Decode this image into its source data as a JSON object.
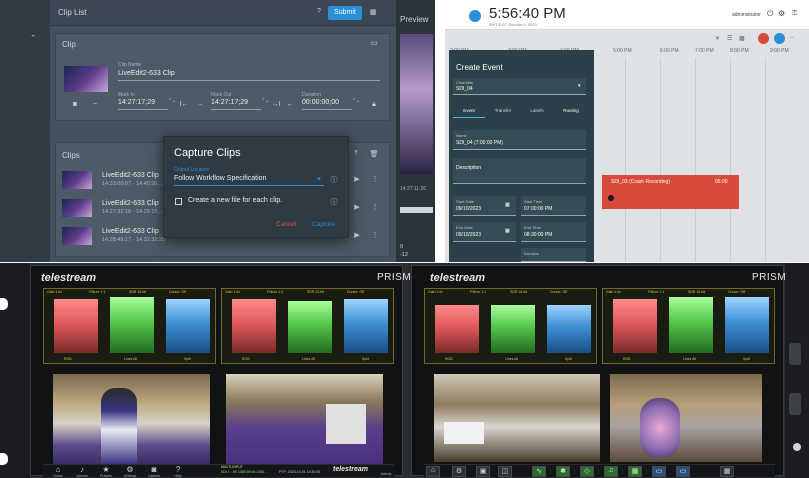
{
  "panel_a": {
    "title": "Clip List",
    "submit": "Submit",
    "preview": "Preview",
    "clip_section": "Clip",
    "clip_name_label": "Clip Name",
    "clip_name": "LiveEdit2-633 Clip",
    "mark_in_label": "Mark In",
    "mark_in": "14:27:17;29",
    "mark_out_label": "Mark Out",
    "mark_out": "14:27:17;29",
    "duration_label": "Duration",
    "duration": "00:00:00;00",
    "clips_section": "Clips",
    "rows": [
      {
        "title": "LiveEdit2-633 Clip",
        "sub": "14:33:00;07 - 14:40:26;..."
      },
      {
        "title": "LiveEdit2-633 Clip",
        "sub": "14:27:32;18 - 14:29:15;..."
      },
      {
        "title": "LiveEdit2-633 Clip",
        "sub": "14:28:49;17 - 14:31:32;25"
      }
    ],
    "preview_tc": "14:27:11:26",
    "dialog": {
      "title": "Capture Clips",
      "output_label": "Output Location",
      "output_value": "Follow Workflow Specification",
      "checkbox": "Create a new file for each clip.",
      "cancel": "Cancel",
      "capture": "Capture"
    },
    "preview_scale": [
      "0",
      "-12"
    ]
  },
  "panel_b": {
    "time": "5:56:40 PM",
    "time_sub": "WPT/EDT    October 9, 2023",
    "admin": "administrator",
    "hours": [
      "2:00 PM",
      "3:00 PM",
      "4:00 PM",
      "5:00 PM",
      "6:00 PM",
      "7:00 PM",
      "8:00 PM",
      "9:00 PM"
    ],
    "create_event": {
      "title": "Create Event",
      "channels_label": "Channels",
      "channel": "SDI_04",
      "tabs": [
        "Event",
        "Transfer",
        "Labels",
        "Routing"
      ],
      "name_label": "Name",
      "name": "SDI_04 (7:00:00 PM)",
      "description_label": "Description",
      "start_date_label": "Start Date",
      "start_date": "09/10/2023",
      "start_time_label": "Start Time",
      "start_time": "07:00:00 PM",
      "end_date_label": "End Date",
      "end_date": "09/10/2023",
      "end_time_label": "End Time",
      "end_time": "08:30:00 PM",
      "duration_label": "Duration"
    },
    "event_block": "SDI_03 (Crash Recording)",
    "event_time": "05:00"
  },
  "rack": {
    "left": {
      "brand": "telestream",
      "model": "PRISM",
      "scope_headers": [
        "Gain 1.0x",
        "FiltLev 1:1",
        "SDR 10-bit",
        "Cursor: Off",
        "Gain 1.0x",
        "FiltLev 1:1",
        "SDR 10-bit",
        "Cursor: Off"
      ],
      "scope_footers": [
        "RGB",
        "Lines All",
        "Split",
        "RGB",
        "Lines All",
        "Split"
      ],
      "nav": [
        "Home",
        "Volume",
        "Presets",
        "Settings",
        "Capture",
        "Help"
      ],
      "meta_1": "MULTI-INPUT",
      "meta_2": "SDI 1 : 4K 1080 59.94 2160...",
      "meta_3": "PTP: 2023-10-01 14:30:30",
      "meta_4": "Activity"
    },
    "right": {
      "brand": "telestream",
      "model": "PRISM",
      "scope_headers": [
        "Gain 1.0x",
        "FiltLev 1:1",
        "SDR 10-bit",
        "Cursor: Off",
        "Gain 1.0x",
        "FiltLev 1:1",
        "SDR 10-bit",
        "Cursor: Off"
      ],
      "scope_footers": [
        "RGB",
        "Lines All",
        "Split",
        "RGB",
        "Lines All",
        "Split"
      ]
    }
  },
  "colors": {
    "accent_blue": "#2b8fd6",
    "event_red": "#d84a3a",
    "scope_amber": "#d8c94a"
  }
}
